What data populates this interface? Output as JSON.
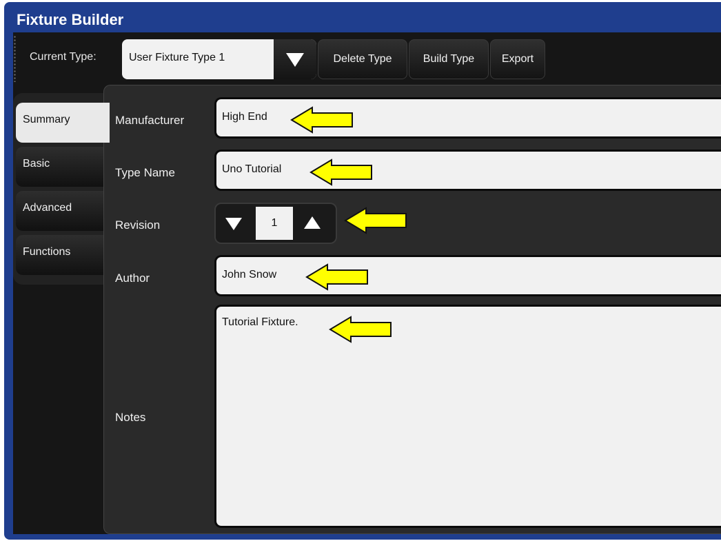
{
  "window": {
    "title": "Fixture Builder"
  },
  "toolbar": {
    "current_type_label": "Current Type:",
    "current_type_value": "User Fixture Type 1",
    "delete_label": "Delete Type",
    "build_label": "Build Type",
    "export_label": "Export"
  },
  "tabs": [
    {
      "label": "Summary",
      "active": true
    },
    {
      "label": "Basic",
      "active": false
    },
    {
      "label": "Advanced",
      "active": false
    },
    {
      "label": "Functions",
      "active": false
    }
  ],
  "form": {
    "manufacturer_label": "Manufacturer",
    "manufacturer_value": "High End",
    "type_name_label": "Type Name",
    "type_name_value": "Uno Tutorial",
    "revision_label": "Revision",
    "revision_value": "1",
    "author_label": "Author",
    "author_value": "John Snow",
    "notes_label": "Notes",
    "notes_value": "Tutorial Fixture."
  },
  "colors": {
    "title_bar": "#1f3e8e",
    "annotation_arrow": "#ffff00"
  },
  "icons": {
    "dropdown": "chevron-down-icon",
    "decrement": "triangle-down-icon",
    "increment": "triangle-up-icon",
    "callout": "yellow-arrow-left-icon"
  }
}
